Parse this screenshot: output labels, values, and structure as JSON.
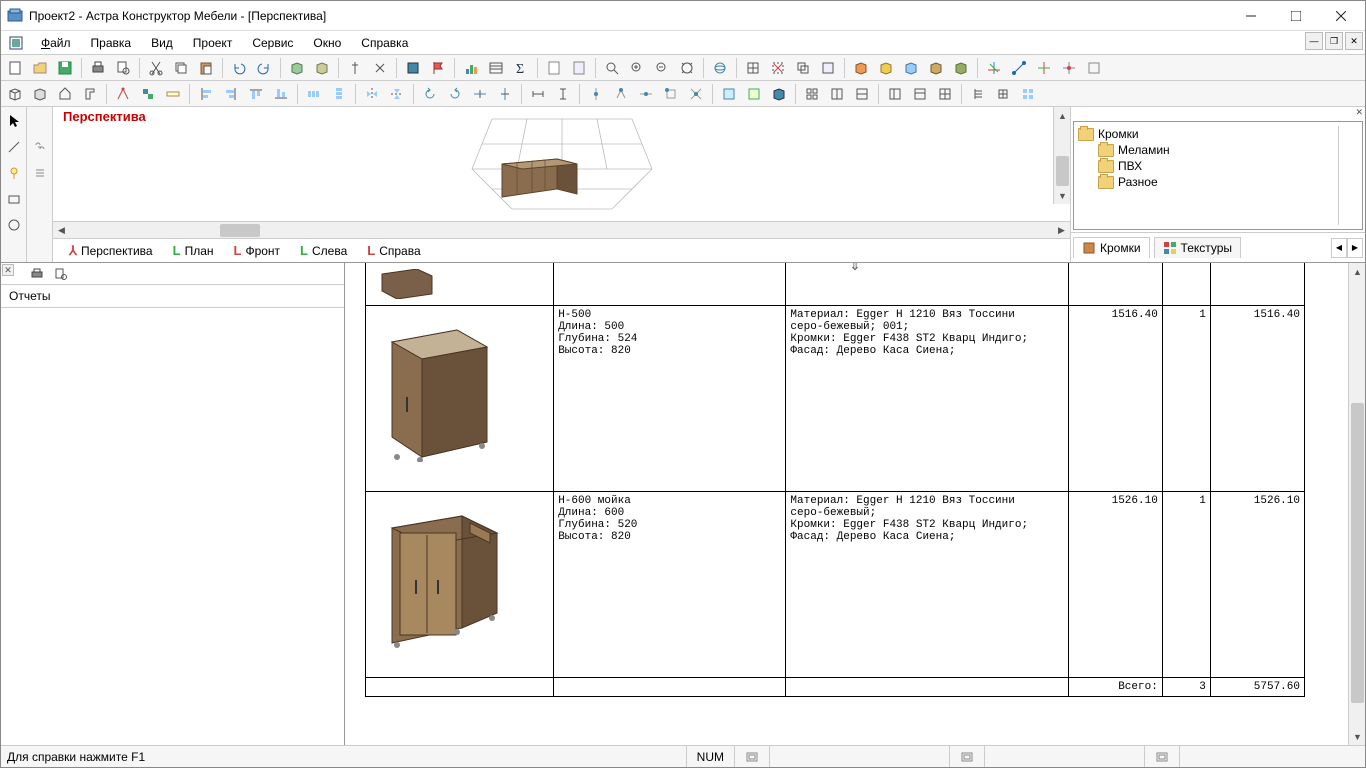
{
  "window": {
    "title": "Проект2 - Астра Конструктор Мебели - [Перспектива]"
  },
  "menu": {
    "file": "Файл",
    "edit": "Правка",
    "view": "Вид",
    "project": "Проект",
    "service": "Сервис",
    "window": "Окно",
    "help": "Справка"
  },
  "viewport": {
    "title": "Перспектива"
  },
  "view_tabs": {
    "perspective": "Перспектива",
    "plan": "План",
    "front": "Фронт",
    "left": "Слева",
    "right": "Справа"
  },
  "materials": {
    "root": "Кромки",
    "items": [
      "Меламин",
      "ПВХ",
      "Разное"
    ],
    "tab_edges": "Кромки",
    "tab_textures": "Текстуры"
  },
  "reports": {
    "header": "Отчеты"
  },
  "table": {
    "rows": [
      {
        "name": "Н-500",
        "length_label": "Длина:",
        "length": "500",
        "depth_label": "Глубина:",
        "depth": "524",
        "height_label": "Высота:",
        "height": "820",
        "mat_line1": "Материал: Egger H 1210 Вяз Тоссини",
        "mat_line2": "серо-бежевый; 001;",
        "mat_line3": "Кромки: Egger F438 ST2 Кварц Индиго;",
        "mat_line4": "Фасад: Дерево Каса Сиена;",
        "price": "1516.40",
        "qty": "1",
        "total": "1516.40"
      },
      {
        "name": "Н-600 мойка",
        "length_label": "Длина:",
        "length": "600",
        "depth_label": "Глубина:",
        "depth": "520",
        "height_label": "Высота:",
        "height": "820",
        "mat_line1": "Материал: Egger H 1210 Вяз Тоссини",
        "mat_line2": "серо-бежевый;",
        "mat_line3": "Кромки: Egger F438 ST2 Кварц Индиго;",
        "mat_line4": "Фасад: Дерево Каса Сиена;",
        "price": "1526.10",
        "qty": "1",
        "total": "1526.10"
      }
    ],
    "footer": {
      "label": "Всего:",
      "qty": "3",
      "total": "5757.60"
    }
  },
  "status": {
    "help": "Для справки нажмите F1",
    "num": "NUM"
  }
}
